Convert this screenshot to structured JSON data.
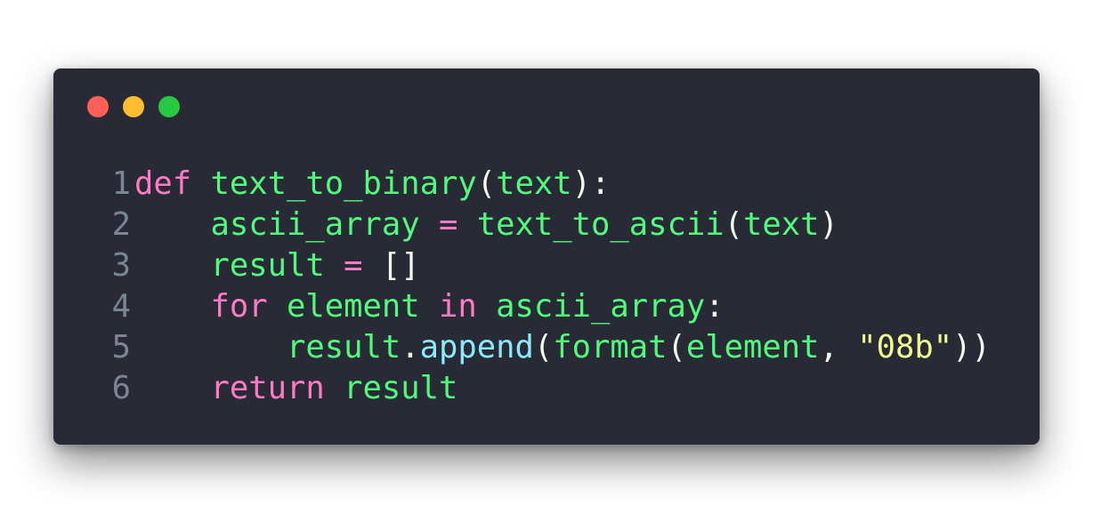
{
  "window": {
    "controls": [
      {
        "name": "close",
        "color": "#ff5f57"
      },
      {
        "name": "minimize",
        "color": "#febc2e"
      },
      {
        "name": "zoom",
        "color": "#28c840"
      }
    ]
  },
  "colors": {
    "background": "#282a36",
    "keyword": "#ff79c6",
    "identifier": "#50fa7b",
    "method": "#8be9fd",
    "string": "#f1fa8c",
    "punctuation": "#f8f8f2",
    "line_number": "#7a8691"
  },
  "code": {
    "lines": [
      {
        "number": "1",
        "tokens": [
          {
            "text": "def",
            "type": "keyword"
          },
          {
            "text": " ",
            "type": "punctuation"
          },
          {
            "text": "text_to_binary",
            "type": "identifier"
          },
          {
            "text": "(",
            "type": "punctuation"
          },
          {
            "text": "text",
            "type": "identifier"
          },
          {
            "text": "):",
            "type": "punctuation"
          }
        ]
      },
      {
        "number": "2",
        "tokens": [
          {
            "text": "    ",
            "type": "punctuation"
          },
          {
            "text": "ascii_array",
            "type": "identifier"
          },
          {
            "text": " ",
            "type": "punctuation"
          },
          {
            "text": "=",
            "type": "keyword"
          },
          {
            "text": " ",
            "type": "punctuation"
          },
          {
            "text": "text_to_ascii",
            "type": "identifier"
          },
          {
            "text": "(",
            "type": "punctuation"
          },
          {
            "text": "text",
            "type": "identifier"
          },
          {
            "text": ")",
            "type": "punctuation"
          }
        ]
      },
      {
        "number": "3",
        "tokens": [
          {
            "text": "    ",
            "type": "punctuation"
          },
          {
            "text": "result",
            "type": "identifier"
          },
          {
            "text": " ",
            "type": "punctuation"
          },
          {
            "text": "=",
            "type": "keyword"
          },
          {
            "text": " ",
            "type": "punctuation"
          },
          {
            "text": "[]",
            "type": "punctuation"
          }
        ]
      },
      {
        "number": "4",
        "tokens": [
          {
            "text": "    ",
            "type": "punctuation"
          },
          {
            "text": "for",
            "type": "keyword"
          },
          {
            "text": " ",
            "type": "punctuation"
          },
          {
            "text": "element",
            "type": "identifier"
          },
          {
            "text": " ",
            "type": "punctuation"
          },
          {
            "text": "in",
            "type": "keyword"
          },
          {
            "text": " ",
            "type": "punctuation"
          },
          {
            "text": "ascii_array",
            "type": "identifier"
          },
          {
            "text": ":",
            "type": "punctuation"
          }
        ]
      },
      {
        "number": "5",
        "tokens": [
          {
            "text": "        ",
            "type": "punctuation"
          },
          {
            "text": "result",
            "type": "identifier"
          },
          {
            "text": ".",
            "type": "punctuation"
          },
          {
            "text": "append",
            "type": "method"
          },
          {
            "text": "(",
            "type": "punctuation"
          },
          {
            "text": "format",
            "type": "identifier"
          },
          {
            "text": "(",
            "type": "punctuation"
          },
          {
            "text": "element",
            "type": "identifier"
          },
          {
            "text": ", ",
            "type": "punctuation"
          },
          {
            "text": "\"08b\"",
            "type": "string"
          },
          {
            "text": "))",
            "type": "punctuation"
          }
        ]
      },
      {
        "number": "6",
        "tokens": [
          {
            "text": "    ",
            "type": "punctuation"
          },
          {
            "text": "return",
            "type": "keyword"
          },
          {
            "text": " ",
            "type": "punctuation"
          },
          {
            "text": "result",
            "type": "identifier"
          }
        ]
      }
    ]
  }
}
